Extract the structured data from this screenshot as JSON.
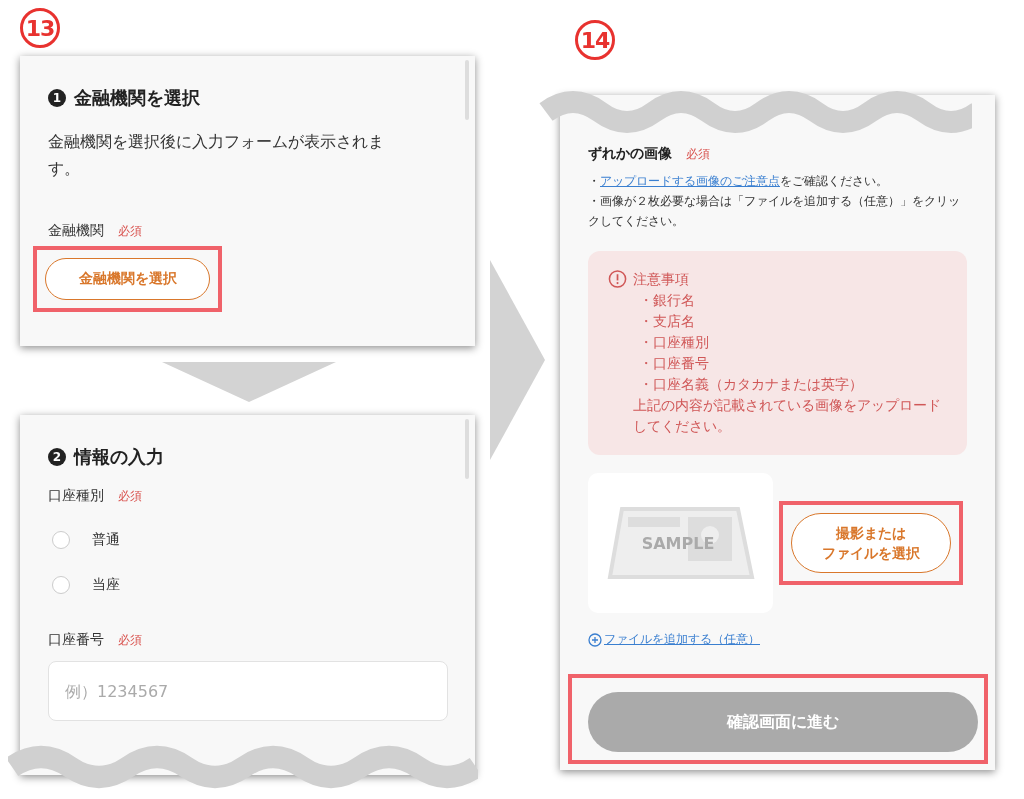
{
  "left_step": {
    "badge": "13"
  },
  "bank_panel": {
    "heading_number": "1",
    "heading": "金融機関を選択",
    "description": "金融機関を選択後に入力フォームが表示されます。",
    "field_label": "金融機関",
    "required": "必須",
    "button": "金融機関を選択",
    "highlighted": true
  },
  "info_panel": {
    "heading_number": "2",
    "heading": "情報の入力",
    "account_type": {
      "label": "口座種別",
      "required": "必須",
      "options": [
        {
          "label": "普通",
          "selected": false
        },
        {
          "label": "当座",
          "selected": false
        }
      ]
    },
    "account_number": {
      "label": "口座番号",
      "required": "必須",
      "placeholder": "例）1234567"
    }
  },
  "right_step": {
    "badge": "14"
  },
  "upload_panel": {
    "field_label": "ずれかの画像",
    "required": "必須",
    "notes": [
      {
        "prefix": "・",
        "link": "アップロードする画像のご注意点",
        "suffix": "をご確認ください。"
      },
      {
        "prefix": "・画像が２枚必要な場合は「ファイルを追加する（任意）」をクリックしてください。"
      }
    ],
    "caution": {
      "title": "注意事項",
      "items": [
        "・銀行名",
        "・支店名",
        "・口座種別",
        "・口座番号",
        "・口座名義（カタカナまたは英字）"
      ],
      "footer": "上記の内容が記載されている画像をアップロードしてください。"
    },
    "sample_label": "SAMPLE",
    "upload_button": {
      "label_lines": [
        "撮影または",
        "ファイルを選択"
      ],
      "highlighted": true
    },
    "add_file": "ファイルを追加する（任意）",
    "submit": {
      "label": "確認画面に進む",
      "disabled": true,
      "highlighted": true
    }
  }
}
